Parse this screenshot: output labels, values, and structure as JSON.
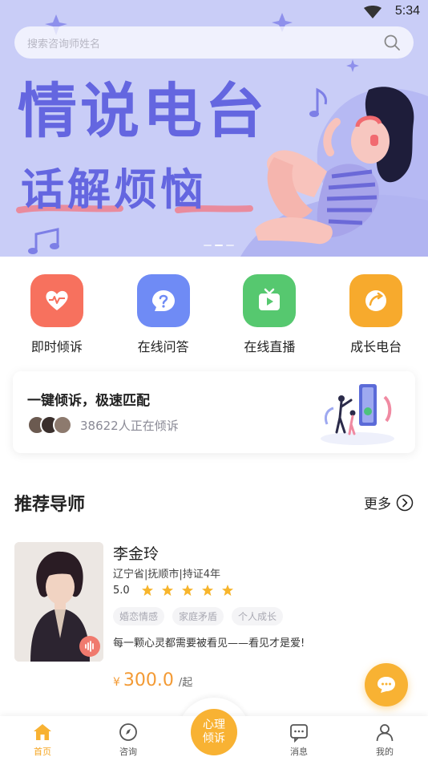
{
  "status_bar": {
    "time": "5:34"
  },
  "search": {
    "placeholder": "搜索咨询师姓名"
  },
  "banner": {
    "title": "情说电台",
    "subtitle": "话解烦恼",
    "slide_count": 3,
    "active_slide": 1
  },
  "quick_menu": [
    {
      "label": "即时倾诉",
      "icon": "heart-pulse-icon",
      "color": "#f7715e"
    },
    {
      "label": "在线问答",
      "icon": "question-bubble-icon",
      "color": "#6f8bf5"
    },
    {
      "label": "在线直播",
      "icon": "tv-play-icon",
      "color": "#56c86f"
    },
    {
      "label": "成长电台",
      "icon": "radio-dial-icon",
      "color": "#f7aa2d"
    }
  ],
  "match_card": {
    "title": "一键倾诉，极速匹配",
    "count_text": "38622人正在倾诉"
  },
  "section": {
    "title": "推荐导师",
    "more_label": "更多"
  },
  "mentor": {
    "name": "李金玲",
    "location": "辽宁省|抚顺市|持证4年",
    "rating": "5.0",
    "stars": 5,
    "tags": [
      "婚恋情感",
      "家庭矛盾",
      "个人成长"
    ],
    "motto": "每一颗心灵都需要被看见——看见才是爱!",
    "price_currency": "¥",
    "price_value": "300.0",
    "price_unit": "/起"
  },
  "bottom_nav": {
    "items": [
      {
        "label": "首页",
        "icon": "home-icon",
        "active": true
      },
      {
        "label": "咨询",
        "icon": "compass-icon",
        "active": false
      },
      {
        "label": "消息",
        "icon": "message-icon",
        "active": false
      },
      {
        "label": "我的",
        "icon": "profile-icon",
        "active": false
      }
    ],
    "center_line1": "心理",
    "center_line2": "倾诉"
  },
  "colors": {
    "accent": "#f8b233",
    "banner_bg": "#c9cdf7",
    "banner_text": "#6466e0",
    "price": "#f39a34"
  }
}
